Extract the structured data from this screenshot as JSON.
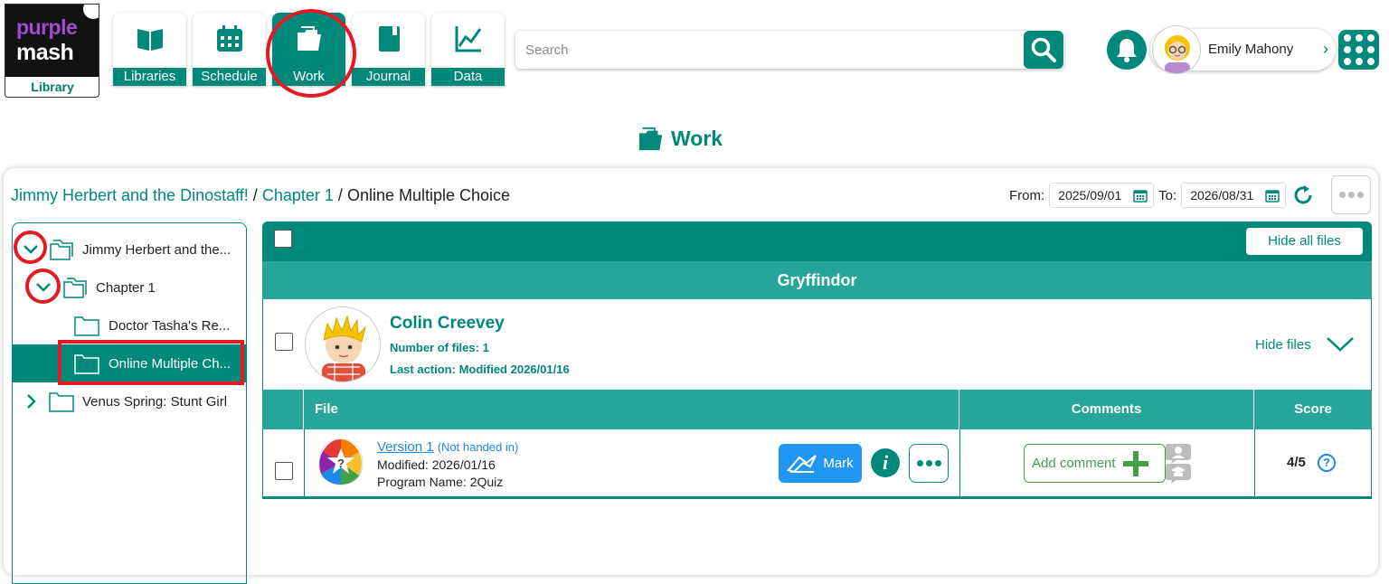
{
  "logo": {
    "line1": "purple",
    "line2": "mash",
    "line3": "Library"
  },
  "nav": [
    {
      "label": "Libraries",
      "icon": "book-icon"
    },
    {
      "label": "Schedule",
      "icon": "calendar-icon"
    },
    {
      "label": "Work",
      "icon": "folder-icon",
      "active": true
    },
    {
      "label": "Journal",
      "icon": "journal-icon"
    },
    {
      "label": "Data",
      "icon": "chart-icon"
    }
  ],
  "search": {
    "placeholder": "Search"
  },
  "user": {
    "name": "Emily Mahony"
  },
  "page": {
    "title": "Work"
  },
  "breadcrumb": {
    "part1": "Jimmy Herbert and the Dinostaff!",
    "part2": "Chapter 1",
    "part3": "Online Multiple Choice",
    "sep": "/"
  },
  "dates": {
    "from_label": "From:",
    "from": "2025/09/01",
    "to_label": "To:",
    "to": "2026/08/31"
  },
  "tree": [
    {
      "label": "Jimmy Herbert and the...",
      "expanded": true
    },
    {
      "label": "Chapter 1",
      "expanded": true
    },
    {
      "label": "Doctor Tasha's Re..."
    },
    {
      "label": "Online Multiple Ch...",
      "selected": true
    },
    {
      "label": "Venus Spring: Stunt Girl",
      "expanded": false
    }
  ],
  "panel": {
    "hide_all": "Hide all files",
    "group": "Gryffindor",
    "pupil": {
      "name": "Colin Creevey",
      "files": "Number of files: 1",
      "last": "Last action: Modified 2026/01/16",
      "hide_files": "Hide files"
    },
    "columns": {
      "file": "File",
      "comments": "Comments",
      "score": "Score"
    },
    "row": {
      "version": "Version 1",
      "status": "(Not handed in)",
      "modified": "Modified: 2026/01/16",
      "program": "Program Name: 2Quiz",
      "mark": "Mark",
      "info": "i",
      "add_comment": "Add comment",
      "score": "4/5",
      "help": "?"
    }
  },
  "colors": {
    "teal": "#00897b",
    "teal_light": "#26a69a",
    "blue": "#2196f3",
    "green": "#43a047",
    "red": "#e01b24"
  }
}
